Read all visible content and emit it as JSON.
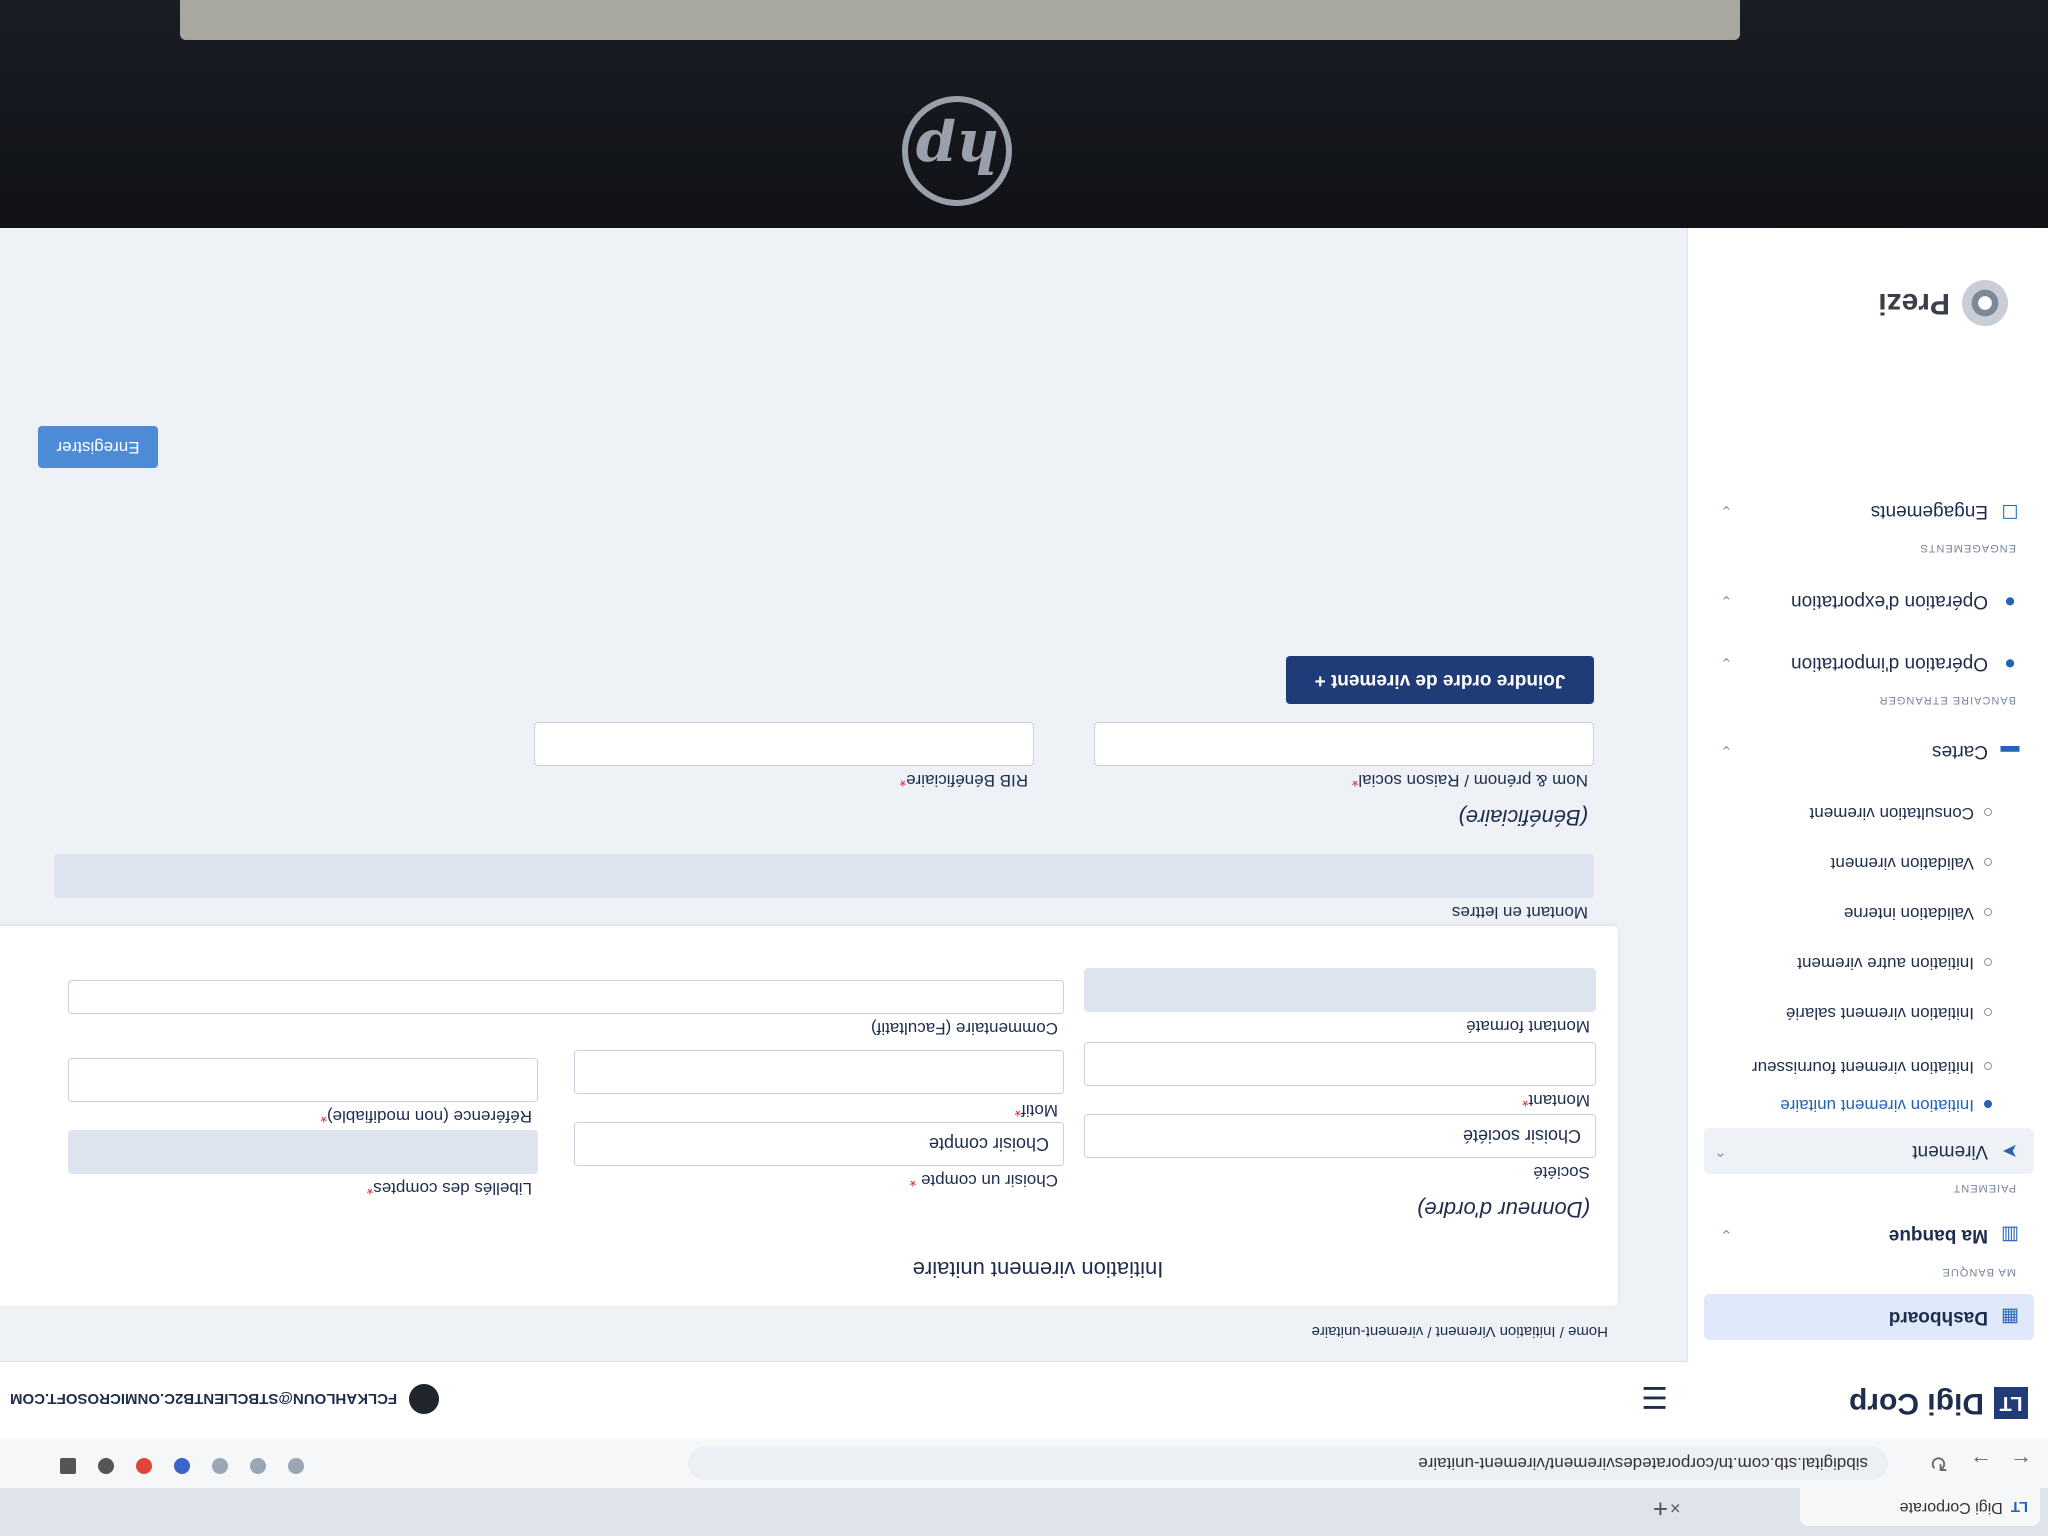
{
  "browser": {
    "tab_title": "Digi Corporate",
    "tab_logo": "LT",
    "url": "sibdigital.stb.com.tn/corporatedesvirement/virement-unitaire",
    "new_tab": "+",
    "close": "×"
  },
  "header": {
    "brand": "Digi Corp",
    "brand_mark": "LT",
    "user_email": "FCLKAHLOUN@STBCLIENTB2C.ONMICROSOFT.COM"
  },
  "sidebar": {
    "dashboard": "Dashboard",
    "section_ma_banque": "MA BANQUE",
    "ma_banque": "Ma banque",
    "section_paiement": "PAIEMENT",
    "virement": "Virement",
    "sub_items": [
      "Initiation virement unitaire",
      "Initiation virement fournisseur",
      "Initiation virement salarié",
      "Initiation autre virement",
      "Validation interne",
      "Validation virement",
      "Consultation virement"
    ],
    "cartes": "Cartes",
    "section_bancaire": "BANCAIRE ETRANGER",
    "importation": "Opération d'importation",
    "exportation": "Opération d'exportation",
    "section_engagements": "ENGAGEMENTS",
    "engagements": "Engagements",
    "prezi": "Prezi"
  },
  "main": {
    "breadcrumb": "Home / Initiation Virement / virement-unitaire",
    "title": "Initiation virement unitaire",
    "donneur": "(Donneur d'ordre)",
    "societe_label": "Société",
    "societe_value": "Choisir société",
    "compte_label": "Choisir un compte",
    "compte_value": "Choisir compte",
    "libelles_label": "Libellés des comptes",
    "montant_label": "Montant",
    "motif_label": "Motif",
    "reference_label": "Référence (non modifiable)",
    "montant_formate_label": "Montant formaté",
    "commentaire_label": "Commentaire (Facultatif)",
    "montant_lettres_label": "Montant en lettres",
    "beneficiaire": "(Bénéficiaire)",
    "nom_label": "Nom & prénom / Raison social",
    "rib_label": "RIB Bénéficiaire",
    "joindre_button": "Joindre ordre de virement  +",
    "save_button": "Enregistrer",
    "required_mark": "*"
  },
  "hp_logo": "hp"
}
